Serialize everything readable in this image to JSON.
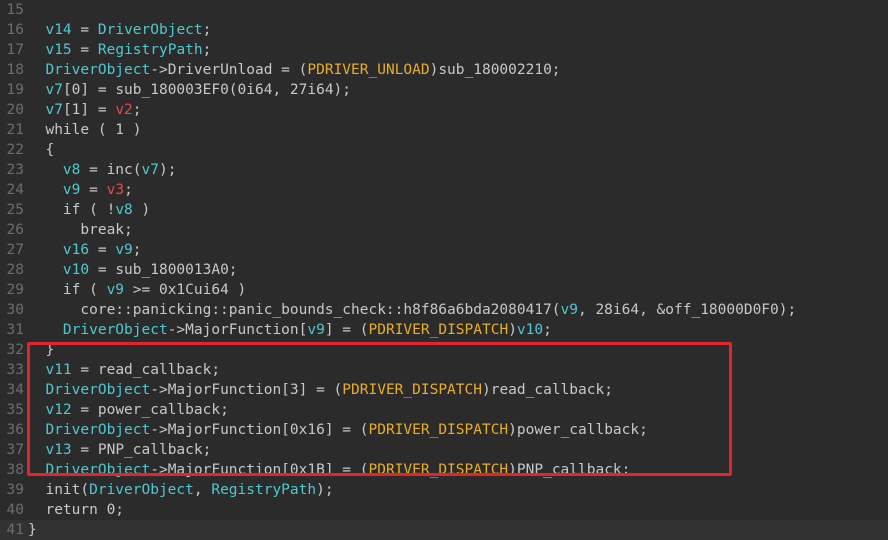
{
  "colors": {
    "background": "#2b2b2b",
    "text": "#c8c8c8",
    "variable": "#4ec9d0",
    "highlight_red": "#e34b4b",
    "type_name": "#e8ad2b",
    "line_number": "#6d6d6d",
    "annotation_box": "#e0262c"
  },
  "lines": [
    {
      "num": "15",
      "tokens": []
    },
    {
      "num": "16",
      "tokens": [
        [
          "t",
          "  "
        ],
        [
          "v",
          "v14"
        ],
        [
          "t",
          " = "
        ],
        [
          "v",
          "DriverObject"
        ],
        [
          "t",
          ";"
        ]
      ]
    },
    {
      "num": "17",
      "tokens": [
        [
          "t",
          "  "
        ],
        [
          "v",
          "v15"
        ],
        [
          "t",
          " = "
        ],
        [
          "v",
          "RegistryPath"
        ],
        [
          "t",
          ";"
        ]
      ]
    },
    {
      "num": "18",
      "tokens": [
        [
          "t",
          "  "
        ],
        [
          "v",
          "DriverObject"
        ],
        [
          "t",
          "->DriverUnload = ("
        ],
        [
          "y",
          "PDRIVER_UNLOAD"
        ],
        [
          "t",
          ")sub_180002210;"
        ]
      ]
    },
    {
      "num": "19",
      "tokens": [
        [
          "t",
          "  "
        ],
        [
          "v",
          "v7"
        ],
        [
          "t",
          "[0] = sub_180003EF0(0i64, 27i64);"
        ]
      ]
    },
    {
      "num": "20",
      "tokens": [
        [
          "t",
          "  "
        ],
        [
          "v",
          "v7"
        ],
        [
          "t",
          "[1] = "
        ],
        [
          "r",
          "v2"
        ],
        [
          "t",
          ";"
        ]
      ]
    },
    {
      "num": "21",
      "tokens": [
        [
          "t",
          "  while ( 1 )"
        ]
      ]
    },
    {
      "num": "22",
      "tokens": [
        [
          "t",
          "  {"
        ]
      ]
    },
    {
      "num": "23",
      "tokens": [
        [
          "t",
          "    "
        ],
        [
          "v",
          "v8"
        ],
        [
          "t",
          " = inc("
        ],
        [
          "v",
          "v7"
        ],
        [
          "t",
          ");"
        ]
      ]
    },
    {
      "num": "24",
      "tokens": [
        [
          "t",
          "    "
        ],
        [
          "v",
          "v9"
        ],
        [
          "t",
          " = "
        ],
        [
          "r",
          "v3"
        ],
        [
          "t",
          ";"
        ]
      ]
    },
    {
      "num": "25",
      "tokens": [
        [
          "t",
          "    if ( !"
        ],
        [
          "v",
          "v8"
        ],
        [
          "t",
          " )"
        ]
      ]
    },
    {
      "num": "26",
      "tokens": [
        [
          "t",
          "      break;"
        ]
      ]
    },
    {
      "num": "27",
      "tokens": [
        [
          "t",
          "    "
        ],
        [
          "v",
          "v16"
        ],
        [
          "t",
          " = "
        ],
        [
          "v",
          "v9"
        ],
        [
          "t",
          ";"
        ]
      ]
    },
    {
      "num": "28",
      "tokens": [
        [
          "t",
          "    "
        ],
        [
          "v",
          "v10"
        ],
        [
          "t",
          " = sub_1800013A0;"
        ]
      ]
    },
    {
      "num": "29",
      "tokens": [
        [
          "t",
          "    if ( "
        ],
        [
          "v",
          "v9"
        ],
        [
          "t",
          " >= 0x1Cui64 )"
        ]
      ]
    },
    {
      "num": "30",
      "tokens": [
        [
          "t",
          "      core::panicking::panic_bounds_check::h8f86a6bda2080417("
        ],
        [
          "v",
          "v9"
        ],
        [
          "t",
          ", 28i64, &off_18000D0F0);"
        ]
      ]
    },
    {
      "num": "31",
      "tokens": [
        [
          "t",
          "    "
        ],
        [
          "v",
          "DriverObject"
        ],
        [
          "t",
          "->MajorFunction["
        ],
        [
          "v",
          "v9"
        ],
        [
          "t",
          "] = ("
        ],
        [
          "y",
          "PDRIVER_DISPATCH"
        ],
        [
          "t",
          ")"
        ],
        [
          "v",
          "v10"
        ],
        [
          "t",
          ";"
        ]
      ]
    },
    {
      "num": "32",
      "tokens": [
        [
          "t",
          "  }"
        ]
      ]
    },
    {
      "num": "33",
      "tokens": [
        [
          "t",
          "  "
        ],
        [
          "v",
          "v11"
        ],
        [
          "t",
          " = read_callback;"
        ]
      ]
    },
    {
      "num": "34",
      "tokens": [
        [
          "t",
          "  "
        ],
        [
          "v",
          "DriverObject"
        ],
        [
          "t",
          "->MajorFunction[3] = ("
        ],
        [
          "y",
          "PDRIVER_DISPATCH"
        ],
        [
          "t",
          ")read_callback;"
        ]
      ]
    },
    {
      "num": "35",
      "tokens": [
        [
          "t",
          "  "
        ],
        [
          "v",
          "v12"
        ],
        [
          "t",
          " = power_callback;"
        ]
      ]
    },
    {
      "num": "36",
      "tokens": [
        [
          "t",
          "  "
        ],
        [
          "v",
          "DriverObject"
        ],
        [
          "t",
          "->MajorFunction[0x16] = ("
        ],
        [
          "y",
          "PDRIVER_DISPATCH"
        ],
        [
          "t",
          ")power_callback;"
        ]
      ]
    },
    {
      "num": "37",
      "tokens": [
        [
          "t",
          "  "
        ],
        [
          "v",
          "v13"
        ],
        [
          "t",
          " = PNP_callback;"
        ]
      ]
    },
    {
      "num": "38",
      "tokens": [
        [
          "t",
          "  "
        ],
        [
          "v",
          "DriverObject"
        ],
        [
          "t",
          "->MajorFunction[0x1B] = ("
        ],
        [
          "y",
          "PDRIVER_DISPATCH"
        ],
        [
          "t",
          ")PNP_callback;"
        ]
      ]
    },
    {
      "num": "39",
      "tokens": [
        [
          "t",
          "  init("
        ],
        [
          "v",
          "DriverObject"
        ],
        [
          "t",
          ", "
        ],
        [
          "v",
          "RegistryPath"
        ],
        [
          "t",
          ");"
        ]
      ]
    },
    {
      "num": "40",
      "tokens": [
        [
          "t",
          "  return 0;"
        ]
      ]
    },
    {
      "num": "41",
      "tokens": [
        [
          "t",
          "}"
        ]
      ]
    }
  ]
}
